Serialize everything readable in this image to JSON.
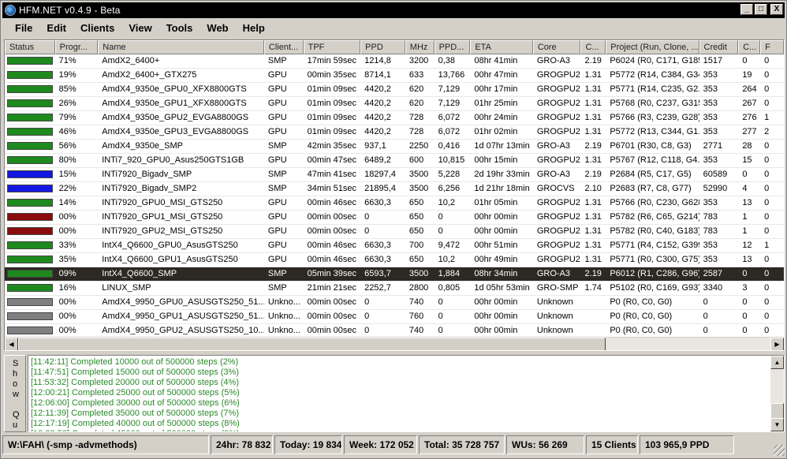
{
  "window": {
    "title": "HFM.NET v0.4.9 - Beta",
    "buttons": {
      "minimize": "_",
      "maximize": "□",
      "close": "X"
    }
  },
  "menu": [
    "File",
    "Edit",
    "Clients",
    "View",
    "Tools",
    "Web",
    "Help"
  ],
  "columns": [
    "Status",
    "Progr...",
    "Name",
    "Client...",
    "TPF",
    "PPD",
    "MHz",
    "PPD...",
    "ETA",
    "Core",
    "C...",
    "Project (Run, Clone, ...",
    "Credit",
    "C...",
    "F"
  ],
  "status_colors": {
    "green": "#1e8a1e",
    "blue": "#1218e0",
    "red": "#8a0c0c",
    "gray": "#808080"
  },
  "rows": [
    {
      "status": "green",
      "progress": "71%",
      "name": "AmdX2_6400+",
      "client": "SMP",
      "tpf": "17min 59sec",
      "ppd": "1214,8",
      "mhz": "3200",
      "ppd_mhz": "0,38",
      "eta": "08hr 41min",
      "core": "GRO-A3",
      "cv": "2.19",
      "project": "P6024 (R0, C171, G185)",
      "credit": "1517",
      "completed": "0",
      "failed": "0"
    },
    {
      "status": "green",
      "progress": "19%",
      "name": "AmdX2_6400+_GTX275",
      "client": "GPU",
      "tpf": "00min 35sec",
      "ppd": "8714,1",
      "mhz": "633",
      "ppd_mhz": "13,766",
      "eta": "00hr 47min",
      "core": "GROGPU2",
      "cv": "1.31",
      "project": "P5772 (R14, C384, G34)",
      "credit": "353",
      "completed": "19",
      "failed": "0"
    },
    {
      "status": "green",
      "progress": "85%",
      "name": "AmdX4_9350e_GPU0_XFX8800GTS",
      "client": "GPU",
      "tpf": "01min 09sec",
      "ppd": "4420,2",
      "mhz": "620",
      "ppd_mhz": "7,129",
      "eta": "00hr 17min",
      "core": "GROGPU2",
      "cv": "1.31",
      "project": "P5771 (R14, C235, G2...",
      "credit": "353",
      "completed": "264",
      "failed": "0"
    },
    {
      "status": "green",
      "progress": "26%",
      "name": "AmdX4_9350e_GPU1_XFX8800GTS",
      "client": "GPU",
      "tpf": "01min 09sec",
      "ppd": "4420,2",
      "mhz": "620",
      "ppd_mhz": "7,129",
      "eta": "01hr 25min",
      "core": "GROGPU2",
      "cv": "1.31",
      "project": "P5768 (R0, C237, G315)",
      "credit": "353",
      "completed": "267",
      "failed": "0"
    },
    {
      "status": "green",
      "progress": "79%",
      "name": "AmdX4_9350e_GPU2_EVGA8800GS",
      "client": "GPU",
      "tpf": "01min 09sec",
      "ppd": "4420,2",
      "mhz": "728",
      "ppd_mhz": "6,072",
      "eta": "00hr 24min",
      "core": "GROGPU2",
      "cv": "1.31",
      "project": "P5766 (R3, C239, G28)",
      "credit": "353",
      "completed": "276",
      "failed": "1"
    },
    {
      "status": "green",
      "progress": "46%",
      "name": "AmdX4_9350e_GPU3_EVGA8800GS",
      "client": "GPU",
      "tpf": "01min 09sec",
      "ppd": "4420,2",
      "mhz": "728",
      "ppd_mhz": "6,072",
      "eta": "01hr 02min",
      "core": "GROGPU2",
      "cv": "1.31",
      "project": "P5772 (R13, C344, G1...",
      "credit": "353",
      "completed": "277",
      "failed": "2"
    },
    {
      "status": "green",
      "progress": "56%",
      "name": "AmdX4_9350e_SMP",
      "client": "SMP",
      "tpf": "42min 35sec",
      "ppd": "937,1",
      "mhz": "2250",
      "ppd_mhz": "0,416",
      "eta": "1d 07hr 13min",
      "core": "GRO-A3",
      "cv": "2.19",
      "project": "P6701 (R30, C8, G3)",
      "credit": "2771",
      "completed": "28",
      "failed": "0"
    },
    {
      "status": "green",
      "progress": "80%",
      "name": "INTi7_920_GPU0_Asus250GTS1GB",
      "client": "GPU",
      "tpf": "00min 47sec",
      "ppd": "6489,2",
      "mhz": "600",
      "ppd_mhz": "10,815",
      "eta": "00hr 15min",
      "core": "GROGPU2",
      "cv": "1.31",
      "project": "P5767 (R12, C118, G4...",
      "credit": "353",
      "completed": "15",
      "failed": "0"
    },
    {
      "status": "blue",
      "progress": "15%",
      "name": "INTi7920_Bigadv_SMP",
      "client": "SMP",
      "tpf": "47min 41sec",
      "ppd": "18297,4",
      "mhz": "3500",
      "ppd_mhz": "5,228",
      "eta": "2d 19hr 33min",
      "core": "GRO-A3",
      "cv": "2.19",
      "project": "P2684 (R5, C17, G5)",
      "credit": "60589",
      "completed": "0",
      "failed": "0"
    },
    {
      "status": "blue",
      "progress": "22%",
      "name": "INTi7920_Bigadv_SMP2",
      "client": "SMP",
      "tpf": "34min 51sec",
      "ppd": "21895,4",
      "mhz": "3500",
      "ppd_mhz": "6,256",
      "eta": "1d 21hr 18min",
      "core": "GROCVS",
      "cv": "2.10",
      "project": "P2683 (R7, C8, G77)",
      "credit": "52990",
      "completed": "4",
      "failed": "0"
    },
    {
      "status": "green",
      "progress": "14%",
      "name": "INTi7920_GPU0_MSI_GTS250",
      "client": "GPU",
      "tpf": "00min 46sec",
      "ppd": "6630,3",
      "mhz": "650",
      "ppd_mhz": "10,2",
      "eta": "01hr 05min",
      "core": "GROGPU2",
      "cv": "1.31",
      "project": "P5766 (R0, C230, G628)",
      "credit": "353",
      "completed": "13",
      "failed": "0"
    },
    {
      "status": "red",
      "progress": "00%",
      "name": "INTi7920_GPU1_MSI_GTS250",
      "client": "GPU",
      "tpf": "00min 00sec",
      "ppd": "0",
      "mhz": "650",
      "ppd_mhz": "0",
      "eta": "00hr 00min",
      "core": "GROGPU2",
      "cv": "1.31",
      "project": "P5782 (R6, C65, G214)",
      "credit": "783",
      "completed": "1",
      "failed": "0"
    },
    {
      "status": "red",
      "progress": "00%",
      "name": "INTi7920_GPU2_MSI_GTS250",
      "client": "GPU",
      "tpf": "00min 00sec",
      "ppd": "0",
      "mhz": "650",
      "ppd_mhz": "0",
      "eta": "00hr 00min",
      "core": "GROGPU2",
      "cv": "1.31",
      "project": "P5782 (R0, C40, G183)",
      "credit": "783",
      "completed": "1",
      "failed": "0"
    },
    {
      "status": "green",
      "progress": "33%",
      "name": "IntX4_Q6600_GPU0_AsusGTS250",
      "client": "GPU",
      "tpf": "00min 46sec",
      "ppd": "6630,3",
      "mhz": "700",
      "ppd_mhz": "9,472",
      "eta": "00hr 51min",
      "core": "GROGPU2",
      "cv": "1.31",
      "project": "P5771 (R4, C152, G399)",
      "credit": "353",
      "completed": "12",
      "failed": "1"
    },
    {
      "status": "green",
      "progress": "35%",
      "name": "IntX4_Q6600_GPU1_AsusGTS250",
      "client": "GPU",
      "tpf": "00min 46sec",
      "ppd": "6630,3",
      "mhz": "650",
      "ppd_mhz": "10,2",
      "eta": "00hr 49min",
      "core": "GROGPU2",
      "cv": "1.31",
      "project": "P5771 (R0, C300, G75)",
      "credit": "353",
      "completed": "13",
      "failed": "0"
    },
    {
      "status": "green",
      "progress": "09%",
      "name": "IntX4_Q6600_SMP",
      "client": "SMP",
      "tpf": "05min 39sec",
      "ppd": "6593,7",
      "mhz": "3500",
      "ppd_mhz": "1,884",
      "eta": "08hr 34min",
      "core": "GRO-A3",
      "cv": "2.19",
      "project": "P6012 (R1, C286, G96)",
      "credit": "2587",
      "completed": "0",
      "failed": "0",
      "selected": true
    },
    {
      "status": "green",
      "progress": "16%",
      "name": "LINUX_SMP",
      "client": "SMP",
      "tpf": "21min 21sec",
      "ppd": "2252,7",
      "mhz": "2800",
      "ppd_mhz": "0,805",
      "eta": "1d 05hr 53min",
      "core": "GRO-SMP",
      "cv": "1.74",
      "project": "P5102 (R0, C169, G93)",
      "credit": "3340",
      "completed": "3",
      "failed": "0"
    },
    {
      "status": "gray",
      "progress": "00%",
      "name": "AmdX4_9950_GPU0_ASUSGTS250_51...",
      "client": "Unkno...",
      "tpf": "00min 00sec",
      "ppd": "0",
      "mhz": "740",
      "ppd_mhz": "0",
      "eta": "00hr 00min",
      "core": "Unknown",
      "cv": "",
      "project": "P0 (R0, C0, G0)",
      "credit": "0",
      "completed": "0",
      "failed": "0"
    },
    {
      "status": "gray",
      "progress": "00%",
      "name": "AmdX4_9950_GPU1_ASUSGTS250_51...",
      "client": "Unkno...",
      "tpf": "00min 00sec",
      "ppd": "0",
      "mhz": "760",
      "ppd_mhz": "0",
      "eta": "00hr 00min",
      "core": "Unknown",
      "cv": "",
      "project": "P0 (R0, C0, G0)",
      "credit": "0",
      "completed": "0",
      "failed": "0"
    },
    {
      "status": "gray",
      "progress": "00%",
      "name": "AmdX4_9950_GPU2_ASUSGTS250_10...",
      "client": "Unkno...",
      "tpf": "00min 00sec",
      "ppd": "0",
      "mhz": "740",
      "ppd_mhz": "0",
      "eta": "00hr 00min",
      "core": "Unknown",
      "cv": "",
      "project": "P0 (R0, C0, G0)",
      "credit": "0",
      "completed": "0",
      "failed": "0"
    }
  ],
  "log_side_label": [
    "S",
    "h",
    "o",
    "w",
    "",
    "Q",
    "u"
  ],
  "log": [
    "[11:42:11] Completed 10000 out of 500000 steps  (2%)",
    "[11:47:51] Completed 15000 out of 500000 steps  (3%)",
    "[11:53:32] Completed 20000 out of 500000 steps  (4%)",
    "[12:00:21] Completed 25000 out of 500000 steps  (5%)",
    "[12:06:00] Completed 30000 out of 500000 steps  (6%)",
    "[12:11:39] Completed 35000 out of 500000 steps  (7%)",
    "[12:17:19] Completed 40000 out of 500000 steps  (8%)",
    "[12:22:58] Completed 45000 out of 500000 steps  (9%)"
  ],
  "statusbar": {
    "path": "W:\\FAH\\ (-smp -advmethods)",
    "h24": "24hr: 78 832",
    "today": "Today: 19 834",
    "week": "Week: 172 052",
    "total": "Total: 35 728 757",
    "wus": "WUs: 56 269",
    "clients": "15 Clients",
    "ppd": "103 965,9 PPD"
  }
}
